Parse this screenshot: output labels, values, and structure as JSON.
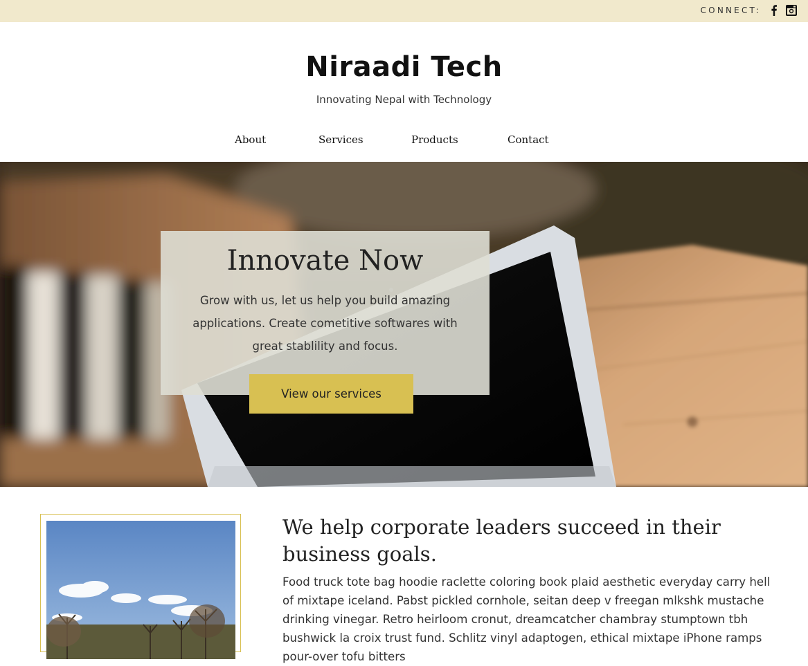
{
  "topbar": {
    "connect_label": "CONNECT:",
    "social": [
      "facebook-icon",
      "instagram-icon"
    ]
  },
  "header": {
    "brand": "Niraadi Tech",
    "tagline": "Innovating Nepal with Technology"
  },
  "nav": {
    "items": [
      {
        "label": "About"
      },
      {
        "label": "Services"
      },
      {
        "label": "Products"
      },
      {
        "label": "Contact"
      }
    ]
  },
  "hero": {
    "title": "Innovate Now",
    "text": "Grow with us, let us help you build amazing applications. Create cometitive softwares with great stablility and focus.",
    "button_label": "View our services"
  },
  "about": {
    "heading": "We help corporate leaders succeed in their business goals.",
    "text": "Food truck tote bag hoodie raclette coloring book plaid aesthetic everyday carry hell of mixtape iceland. Pabst pickled cornhole, seitan deep v freegan mlkshk mustache drinking vinegar. Retro heirloom cronut, dreamcatcher chambray stumptown tbh bushwick la croix trust fund. Schlitz vinyl adaptogen, ethical mixtape iPhone ramps pour-over tofu bitters"
  },
  "colors": {
    "topbar": "#f1e9cc",
    "accent": "#d8c052",
    "text": "#222222"
  }
}
